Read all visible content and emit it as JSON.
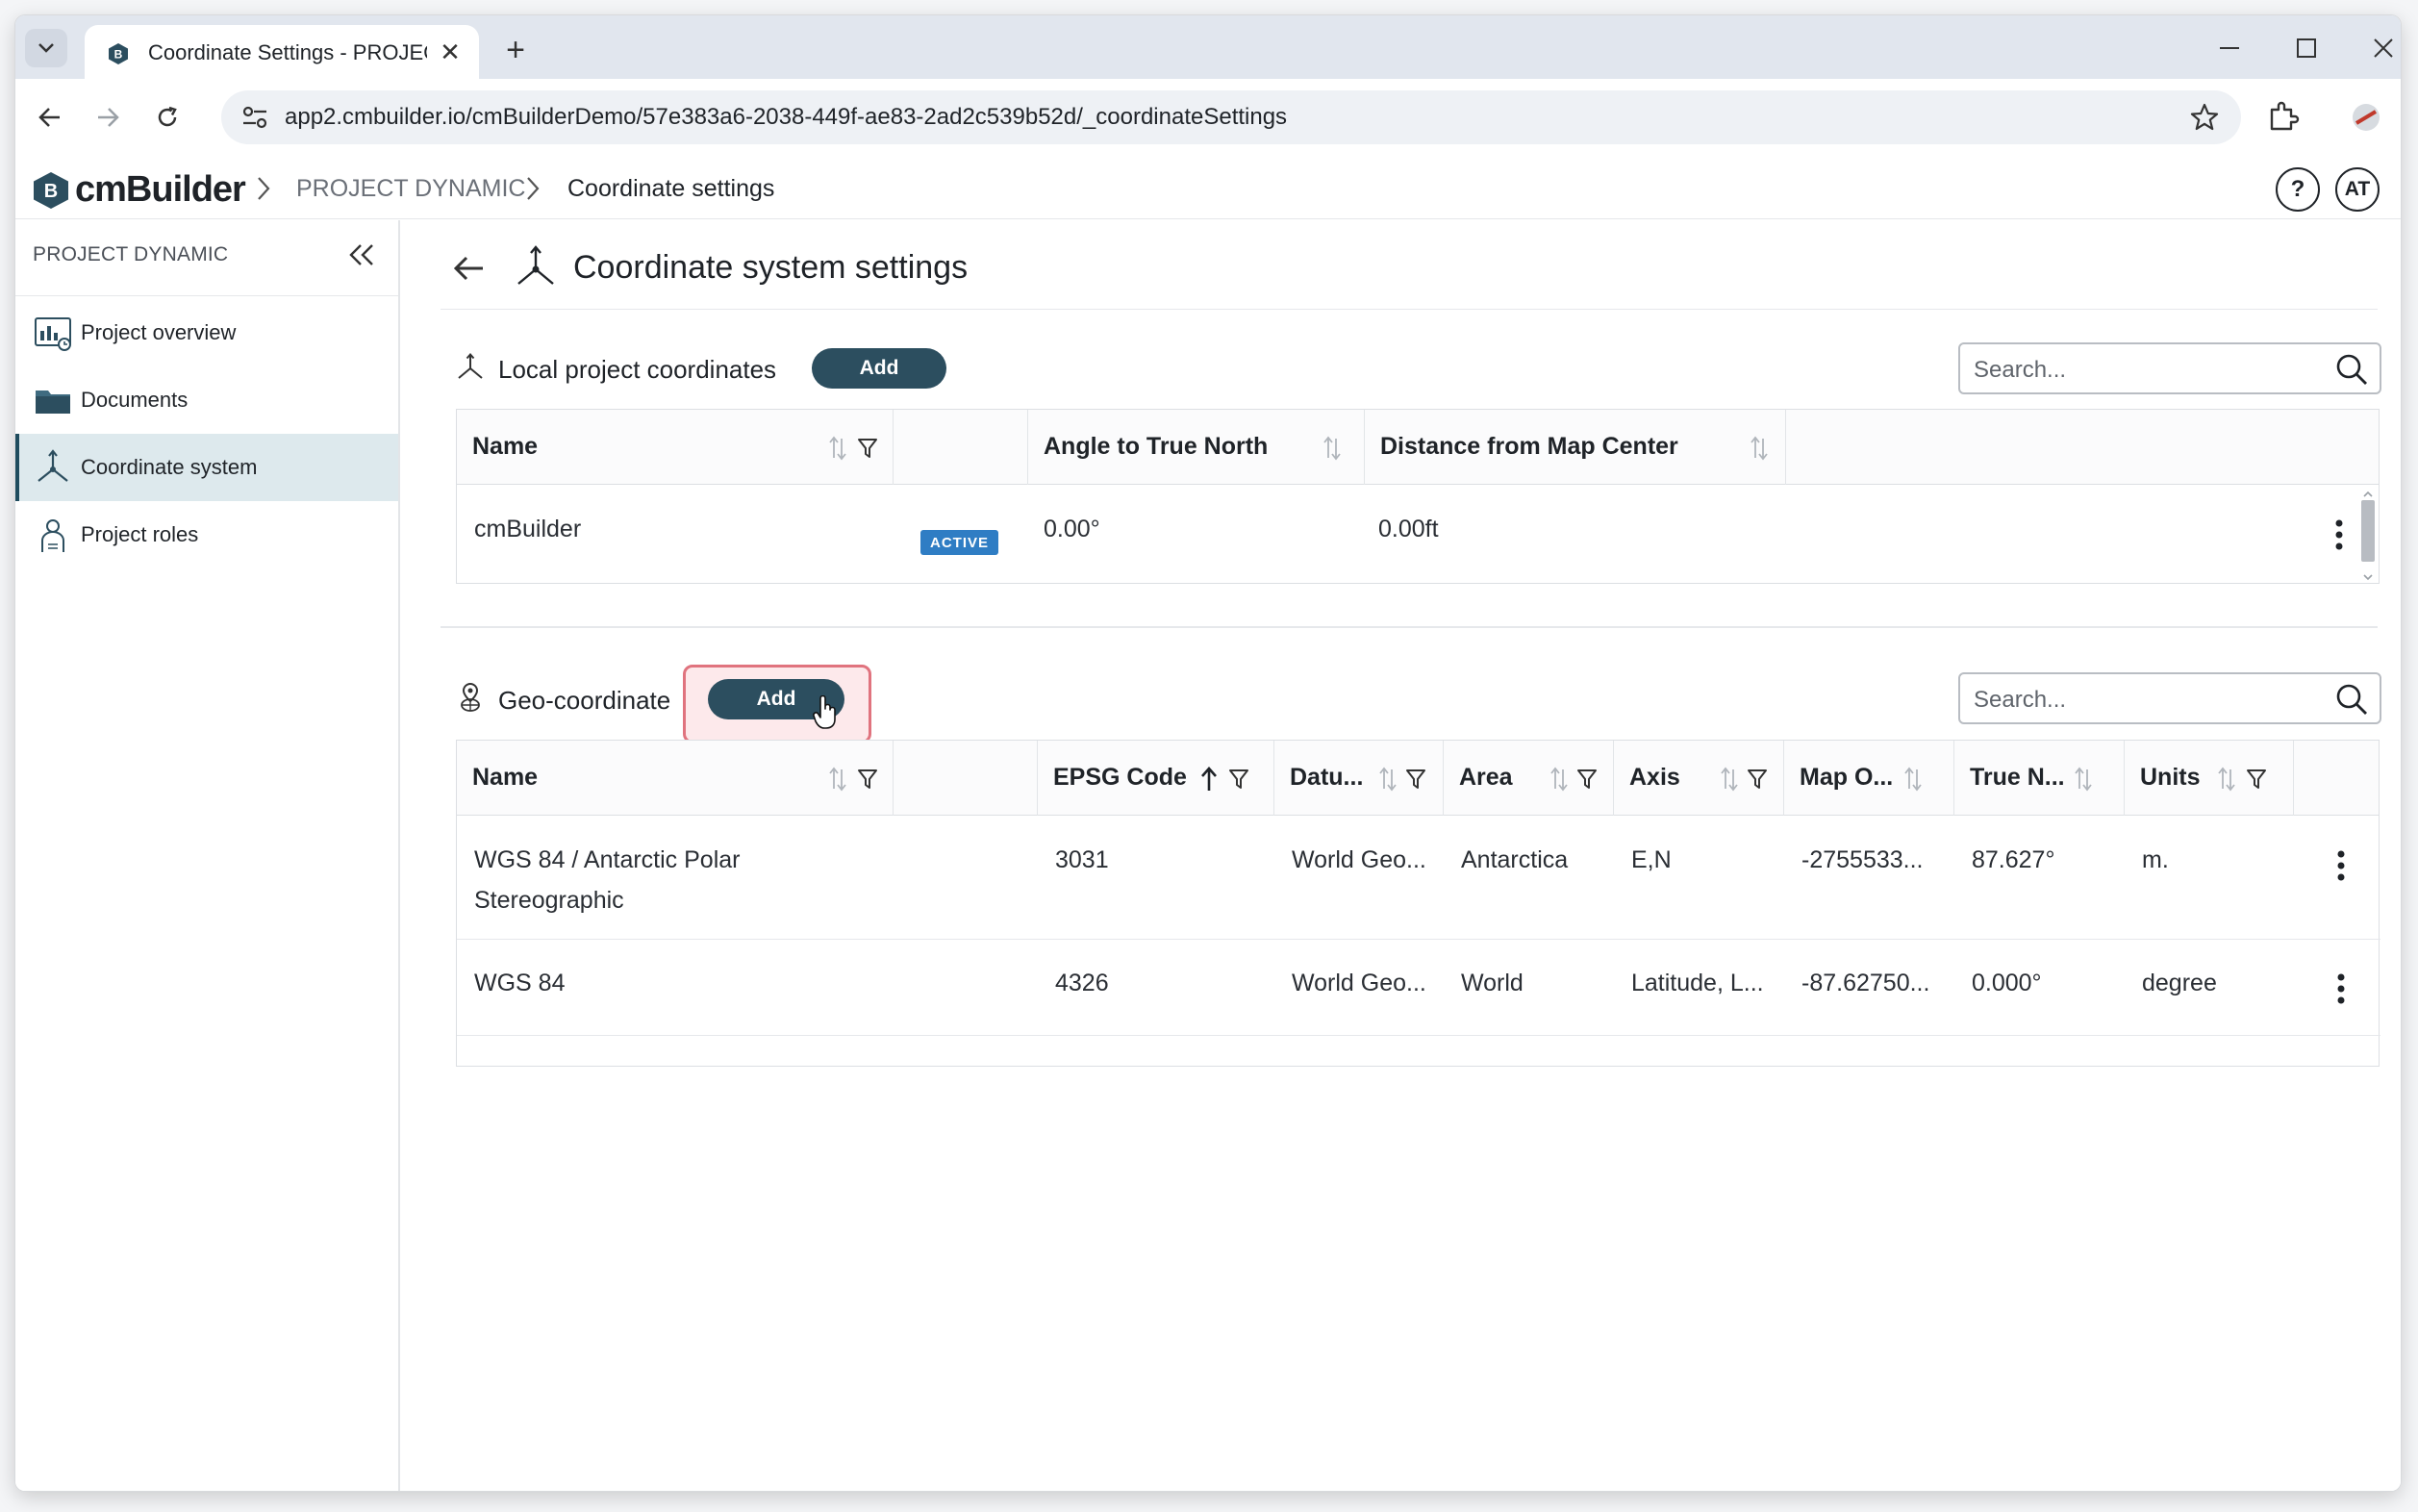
{
  "browser": {
    "tab_title": "Coordinate Settings - PROJECT",
    "url": "app2.cmbuilder.io/cmBuilderDemo/57e383a6-2038-449f-ae83-2ad2c539b52d/_coordinateSettings"
  },
  "header": {
    "brand": "cmBuilder",
    "breadcrumb": [
      "PROJECT DYNAMIC",
      "Coordinate settings"
    ],
    "help": "?",
    "avatar": "AT"
  },
  "sidebar": {
    "title": "PROJECT DYNAMIC",
    "items": [
      {
        "label": "Project overview",
        "icon": "dashboard-icon"
      },
      {
        "label": "Documents",
        "icon": "folder-icon"
      },
      {
        "label": "Coordinate system",
        "icon": "axes-icon",
        "active": true
      },
      {
        "label": "Project roles",
        "icon": "people-icon"
      }
    ]
  },
  "page": {
    "title": "Coordinate system settings"
  },
  "local": {
    "label": "Local project coordinates",
    "add": "Add",
    "search_placeholder": "Search...",
    "columns": [
      "Name",
      "Angle to True North",
      "Distance from Map Center"
    ],
    "rows": [
      {
        "name": "cmBuilder",
        "status": "ACTIVE",
        "angle": "0.00°",
        "distance": "0.00ft"
      }
    ]
  },
  "geo": {
    "label": "Geo-coordinate",
    "add": "Add",
    "search_placeholder": "Search...",
    "columns": [
      "Name",
      "EPSG Code",
      "Datu...",
      "Area",
      "Axis",
      "Map O...",
      "True N...",
      "Units"
    ],
    "rows": [
      {
        "name_1": "WGS 84 / Antarctic Polar",
        "name_2": "Stereographic",
        "epsg": "3031",
        "datum": "World Geo...",
        "area": "Antarctica",
        "axis": "E,N",
        "map_o": "-2755533...",
        "true_n": "87.627°",
        "units": "m."
      },
      {
        "name_1": "WGS 84",
        "name_2": "",
        "epsg": "4326",
        "datum": "World Geo...",
        "area": "World",
        "axis": "Latitude, L...",
        "map_o": "-87.62750...",
        "true_n": "0.000°",
        "units": "degree"
      }
    ]
  },
  "colors": {
    "accent": "#2c4e5f",
    "badge": "#2f7dc4",
    "highlight": "#e0737e"
  }
}
